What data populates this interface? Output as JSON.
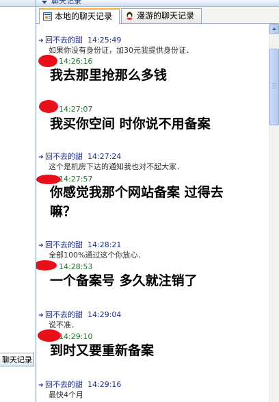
{
  "left": {
    "button_label": "聊天记录"
  },
  "panel": {
    "header_title": "聊天记录",
    "tabs": [
      {
        "label": "本地的聊天记录",
        "icon": "local-history-icon"
      },
      {
        "label": "漫游的聊天记录",
        "icon": "roaming-history-icon"
      }
    ]
  },
  "messages": [
    {
      "sender": "回不去的甜",
      "time": "14:25:49",
      "text": "如果你没有身份证，加30元我提供身份证．",
      "who": "peer"
    },
    {
      "sender": "",
      "time": "14:26:16",
      "text": "我去那里抢那么多钱",
      "who": "me"
    },
    {
      "sender": "",
      "time": "14:27:07",
      "text": "我买你空间 时你说不用备案",
      "who": "me"
    },
    {
      "sender": "回不去的甜",
      "time": "14:27:24",
      "text": "这个是机房下达的通知我也对不起大家．",
      "who": "peer"
    },
    {
      "sender": "",
      "time": "14:27:57",
      "text": "你感觉我那个网站备案 过得去",
      "text2": "嘛？",
      "who": "me"
    },
    {
      "sender": "回不去的甜",
      "time": "14:28:21",
      "text": "全部100%通过这个你放心．",
      "who": "peer"
    },
    {
      "sender": "",
      "time": "14:28:53",
      "text": "一个备案号 多久就注销了",
      "who": "me"
    },
    {
      "sender": "回不去的甜",
      "time": "14:29:04",
      "text": "说不准．",
      "who": "peer"
    },
    {
      "sender": "",
      "time": "14:29:10",
      "text": "到时又要重新备案",
      "who": "me"
    },
    {
      "sender": "回不去的甜",
      "time": "14:29:16",
      "text": "最快4个月",
      "who": "peer"
    }
  ],
  "colors": {
    "peer_name": "#1a2c9c",
    "self_time": "#1e7a2e",
    "redaction": "#e8101a"
  }
}
